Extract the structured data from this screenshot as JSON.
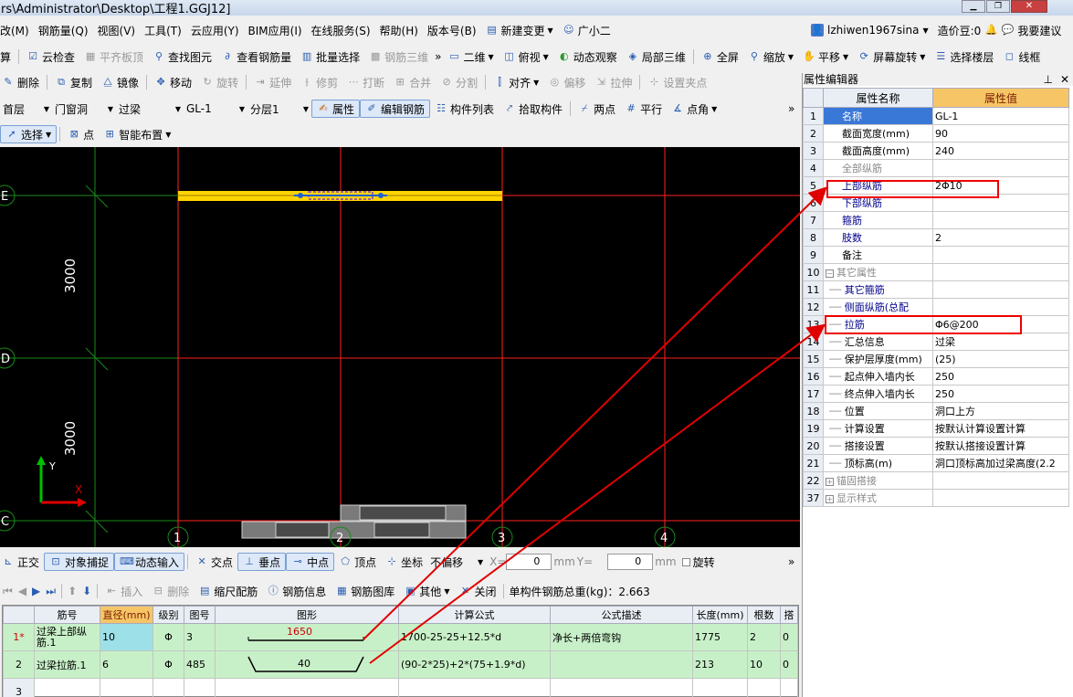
{
  "title": "rs\\Administrator\\Desktop\\工程1.GGJ12]",
  "menu": [
    "改(M)",
    "钢筋量(Q)",
    "视图(V)",
    "工具(T)",
    "云应用(Y)",
    "BIM应用(I)",
    "在线服务(S)",
    "帮助(H)",
    "版本号(B)",
    "新建变更",
    "广小二"
  ],
  "account": {
    "user": "lzhiwen1967sina",
    "beans": "造价豆:0",
    "suggest": "我要建议"
  },
  "toolbar1": [
    "算",
    "云检查",
    "平齐板顶",
    "查找图元",
    "查看钢筋量",
    "批量选择",
    "钢筋三维",
    "二维",
    "俯视",
    "动态观察",
    "局部三维",
    "全屏",
    "缩放",
    "平移",
    "屏幕旋转",
    "选择楼层",
    "线框"
  ],
  "toolbar2": [
    "删除",
    "复制",
    "镜像",
    "移动",
    "旋转",
    "延伸",
    "修剪",
    "打断",
    "合并",
    "分割",
    "对齐",
    "偏移",
    "拉伸",
    "设置夹点"
  ],
  "toolbar3": {
    "floor": "首层",
    "type": "门窗洞",
    "sub": "过梁",
    "member": "GL-1",
    "layer": "分层1",
    "props": "属性",
    "edit_rebar": "编辑钢筋",
    "list": "构件列表",
    "pick": "拾取构件",
    "two_point": "两点",
    "parallel": "平行",
    "point_angle": "点角"
  },
  "toolbar4": [
    "选择",
    "点",
    "智能布置"
  ],
  "canvas": {
    "axis_rows": [
      "E",
      "D",
      "C"
    ],
    "axis_cols": [
      "1",
      "2",
      "3",
      "4"
    ],
    "dims": [
      "3000",
      "3000"
    ],
    "ucs": {
      "x": "X",
      "y": "Y"
    }
  },
  "status_bar": {
    "ortho": "正交",
    "snap": "对象捕捉",
    "dyn": "动态输入",
    "intersect": "交点",
    "perp": "垂点",
    "mid": "中点",
    "vertex": "顶点",
    "coord": "坐标",
    "offset": "不偏移",
    "x_label": "X=",
    "x_val": "0",
    "y_label": "Y=",
    "y_val": "0",
    "unit": "mm",
    "rotate": "旋转"
  },
  "rebar_toolbar": {
    "insert": "插入",
    "delete": "删除",
    "scale": "缩尺配筋",
    "info": "钢筋信息",
    "lib": "钢筋图库",
    "other": "其他",
    "close": "关闭",
    "weight": "单构件钢筋总重(kg)：2.663"
  },
  "rebar_table": {
    "headers": [
      "筋号",
      "直径(mm)",
      "级别",
      "图号",
      "图形",
      "计算公式",
      "公式描述",
      "长度(mm)",
      "根数",
      "搭"
    ],
    "rows": [
      {
        "no": "1*",
        "name": "过梁上部纵筋.1",
        "dia": "10",
        "grade": "Φ",
        "fig": "3",
        "shape_val": "1650",
        "formula": "1700-25-25+12.5*d",
        "desc": "净长+两倍弯钩",
        "len": "1775",
        "count": "2",
        "lap": "0"
      },
      {
        "no": "2",
        "name": "过梁拉筋.1",
        "dia": "6",
        "grade": "Φ",
        "fig": "485",
        "shape_val": "40",
        "formula": "(90-2*25)+2*(75+1.9*d)",
        "desc": "",
        "len": "213",
        "count": "10",
        "lap": "0"
      },
      {
        "no": "3",
        "name": "",
        "dia": "",
        "grade": "",
        "fig": "",
        "shape_val": "",
        "formula": "",
        "desc": "",
        "len": "",
        "count": "",
        "lap": ""
      }
    ]
  },
  "prop_editor": {
    "title": "属性编辑器",
    "head_name": "属性名称",
    "head_value": "属性值",
    "rows": [
      {
        "n": "1",
        "name": "名称",
        "val": "GL-1"
      },
      {
        "n": "2",
        "name": "截面宽度(mm)",
        "val": "90"
      },
      {
        "n": "3",
        "name": "截面高度(mm)",
        "val": "240"
      },
      {
        "n": "4",
        "name": "全部纵筋",
        "val": ""
      },
      {
        "n": "5",
        "name": "上部纵筋",
        "val": "2Φ10"
      },
      {
        "n": "6",
        "name": "下部纵筋",
        "val": ""
      },
      {
        "n": "7",
        "name": "箍筋",
        "val": ""
      },
      {
        "n": "8",
        "name": "肢数",
        "val": "2"
      },
      {
        "n": "9",
        "name": "备注",
        "val": ""
      },
      {
        "n": "10",
        "name": "其它属性",
        "val": ""
      },
      {
        "n": "11",
        "name": "其它箍筋",
        "val": ""
      },
      {
        "n": "12",
        "name": "侧面纵筋(总配",
        "val": ""
      },
      {
        "n": "13",
        "name": "拉筋",
        "val": "Φ6@200"
      },
      {
        "n": "14",
        "name": "汇总信息",
        "val": "过梁"
      },
      {
        "n": "15",
        "name": "保护层厚度(mm)",
        "val": "(25)"
      },
      {
        "n": "16",
        "name": "起点伸入墙内长",
        "val": "250"
      },
      {
        "n": "17",
        "name": "终点伸入墙内长",
        "val": "250"
      },
      {
        "n": "18",
        "name": "位置",
        "val": "洞口上方"
      },
      {
        "n": "19",
        "name": "计算设置",
        "val": "按默认计算设置计算"
      },
      {
        "n": "20",
        "name": "搭接设置",
        "val": "按默认搭接设置计算"
      },
      {
        "n": "21",
        "name": "顶标高(m)",
        "val": "洞口顶标高加过梁高度(2.2"
      },
      {
        "n": "22",
        "name": "锚固搭接",
        "val": ""
      },
      {
        "n": "37",
        "name": "显示样式",
        "val": ""
      }
    ]
  },
  "colors": {
    "accent": "#3a78d8",
    "highlight": "#e00000",
    "grid": "#ff2020",
    "beam": "#ffd400"
  }
}
